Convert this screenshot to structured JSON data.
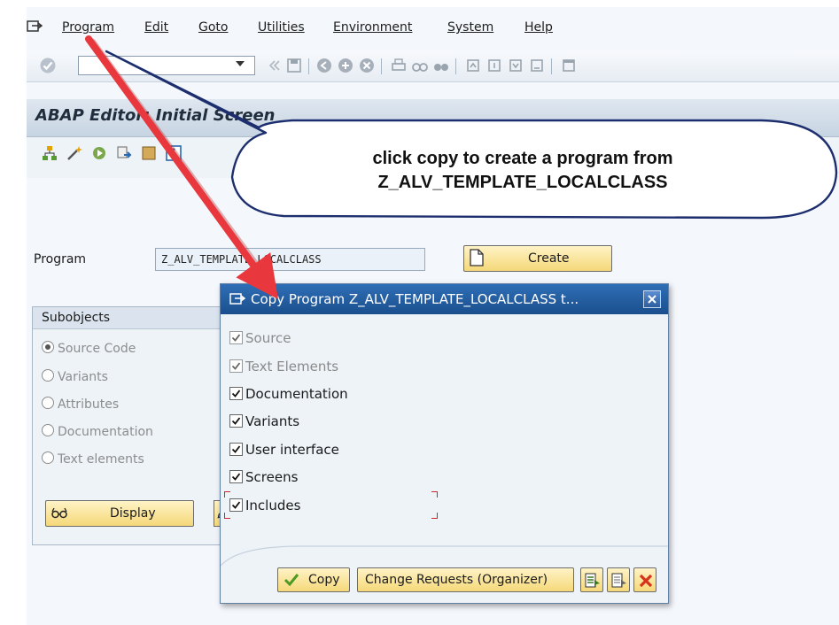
{
  "menubar": {
    "items": [
      {
        "label": "Program",
        "mnemonic": "P"
      },
      {
        "label": "Edit",
        "mnemonic": "E"
      },
      {
        "label": "Goto",
        "mnemonic": "G"
      },
      {
        "label": "Utilities",
        "mnemonic": "U"
      },
      {
        "label": "Environment",
        "mnemonic": "v"
      },
      {
        "label": "System",
        "mnemonic": "S"
      },
      {
        "label": "Help",
        "mnemonic": "H"
      }
    ]
  },
  "toolbar": {
    "command_field_value": ""
  },
  "screen": {
    "title": "ABAP Editor: Initial Screen",
    "program_label": "Program",
    "program_value": "Z_ALV_TEMPLATE_LOCALCLASS",
    "create_label": "Create"
  },
  "subobjects": {
    "title": "Subobjects",
    "options": [
      {
        "label": "Source Code",
        "selected": true
      },
      {
        "label": "Variants",
        "selected": false
      },
      {
        "label": "Attributes",
        "selected": false
      },
      {
        "label": "Documentation",
        "selected": false
      },
      {
        "label": "Text elements",
        "selected": false
      }
    ],
    "display_label": "Display"
  },
  "callout": {
    "line1": "click copy to create a program from",
    "line2": "Z_ALV_TEMPLATE_LOCALCLASS"
  },
  "dialog": {
    "title": "Copy Program Z_ALV_TEMPLATE_LOCALCLASS t...",
    "checkboxes": [
      {
        "label": "Source",
        "checked": true,
        "enabled": false
      },
      {
        "label": "Text Elements",
        "checked": true,
        "enabled": false
      },
      {
        "label": "Documentation",
        "checked": true,
        "enabled": true
      },
      {
        "label": "Variants",
        "checked": true,
        "enabled": true
      },
      {
        "label": "User interface",
        "checked": true,
        "enabled": true
      },
      {
        "label": "Screens",
        "checked": true,
        "enabled": true
      },
      {
        "label": "Includes",
        "checked": true,
        "enabled": true
      }
    ],
    "copy_label": "Copy",
    "change_requests_label": "Change Requests (Organizer)"
  },
  "colors": {
    "sap_button": "#f5d879",
    "dialog_title": "#1a4f8e",
    "annotation_arrow": "#e8383d"
  }
}
